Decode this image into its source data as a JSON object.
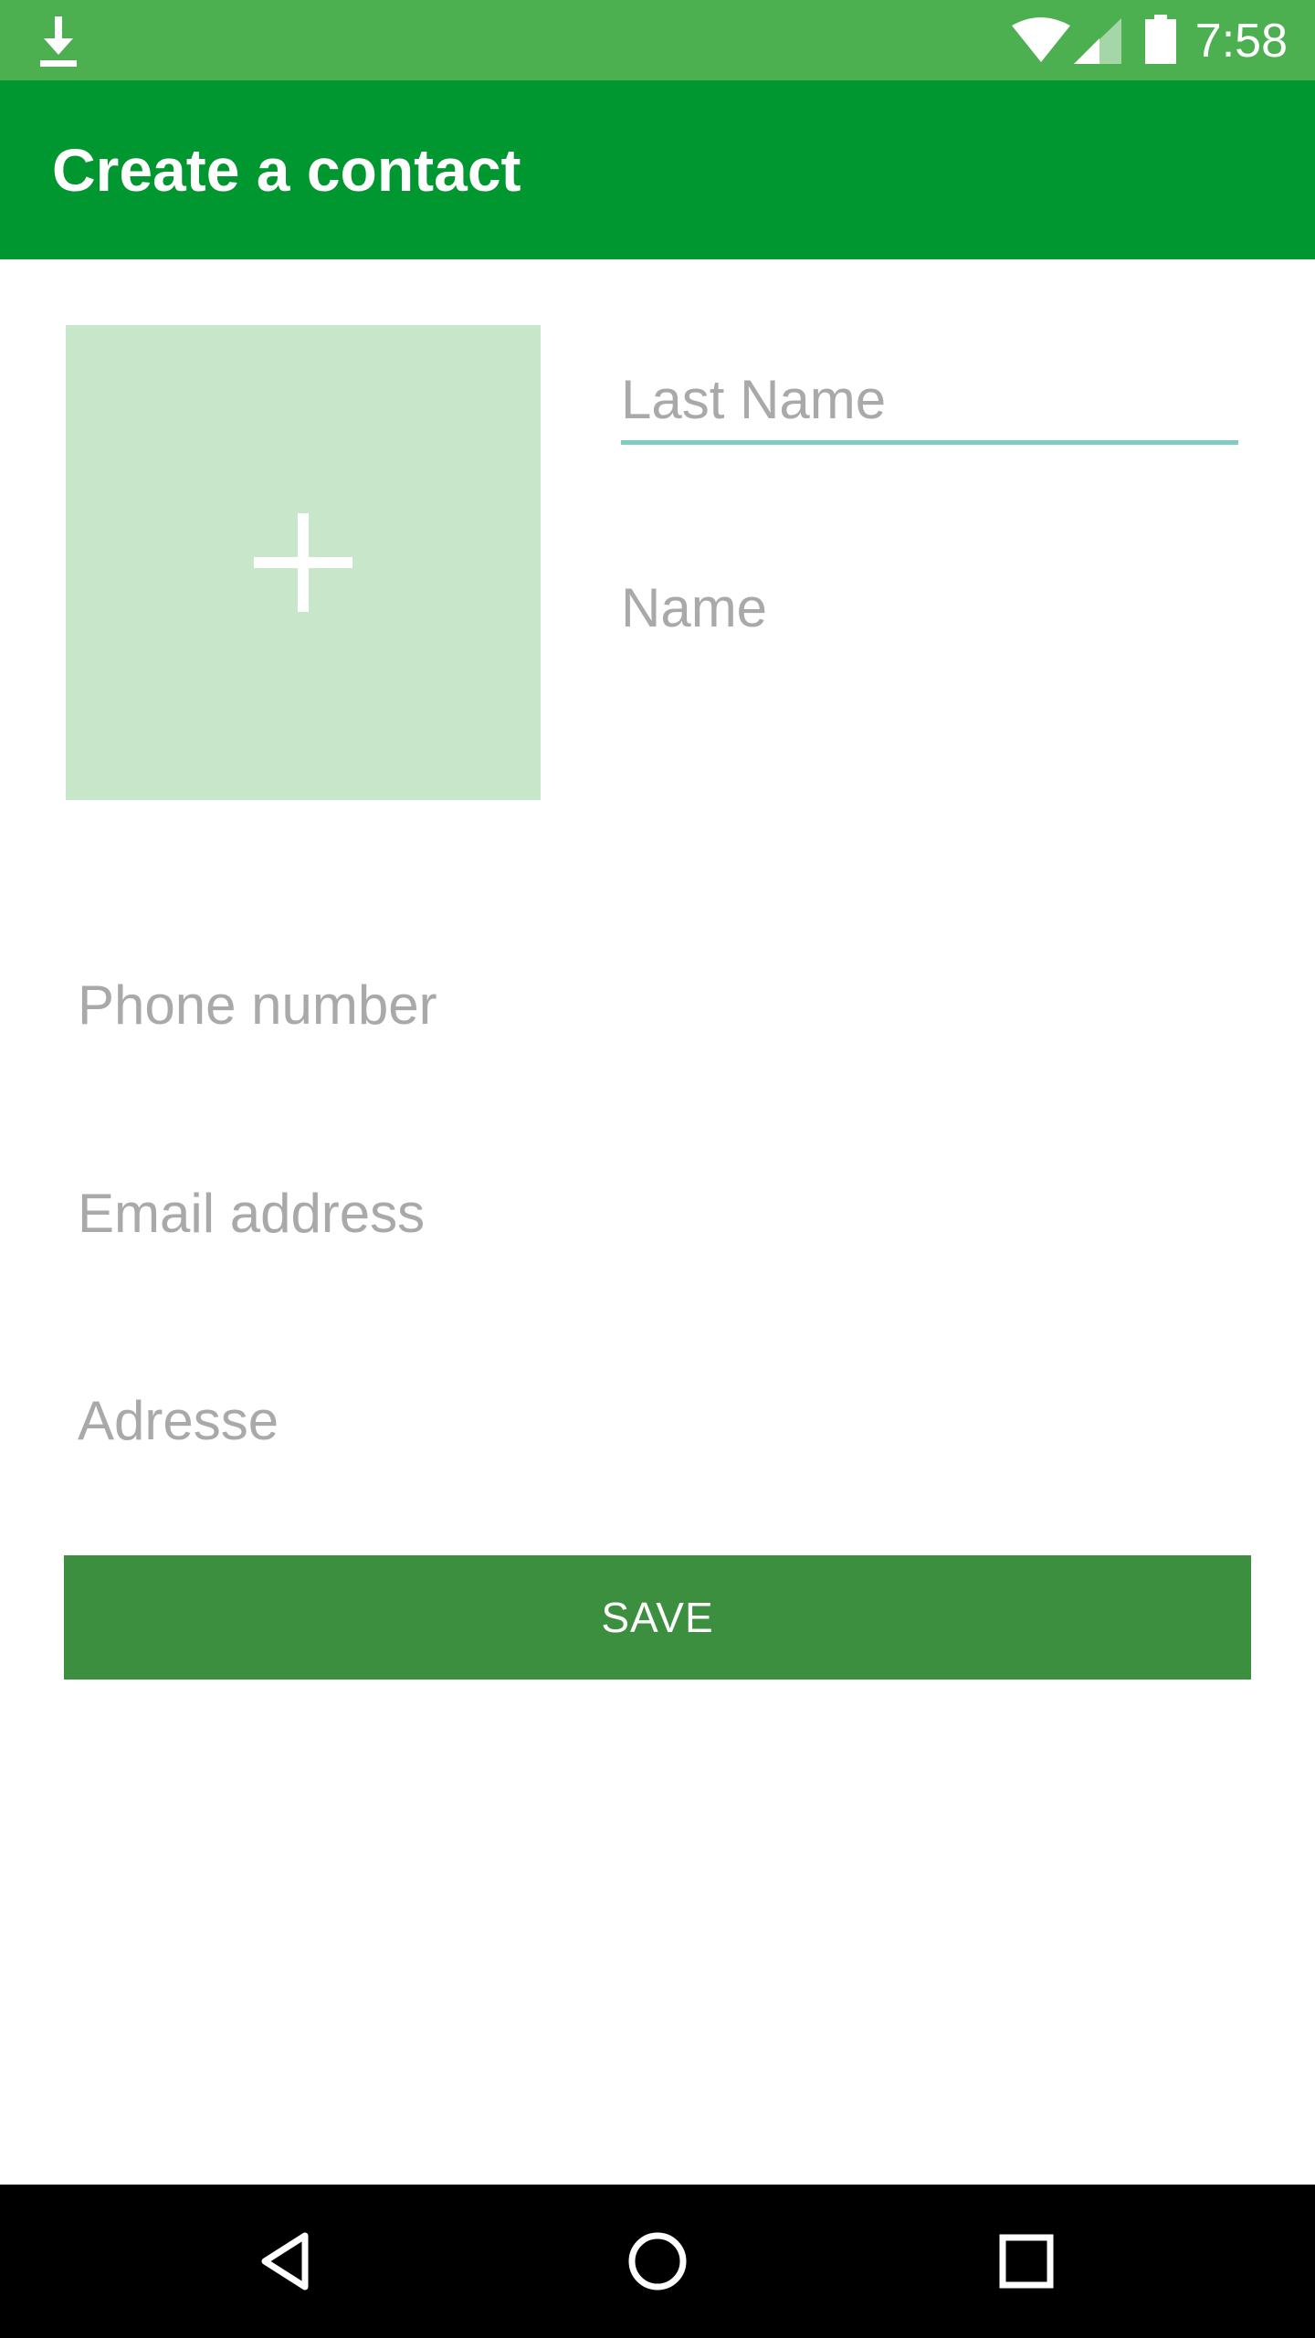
{
  "status_bar": {
    "time": "7:58",
    "color": "#4caf50",
    "icons": [
      "download-icon",
      "wifi-icon",
      "signal-icon",
      "battery-icon"
    ]
  },
  "app_bar": {
    "title": "Create a contact",
    "color": "#009630"
  },
  "photo": {
    "icon": "plus-icon",
    "color": "#c8e6c9"
  },
  "form": {
    "last_name": {
      "placeholder": "Last Name",
      "value": ""
    },
    "name": {
      "placeholder": "Name",
      "value": ""
    },
    "phone": {
      "placeholder": "Phone number",
      "value": ""
    },
    "email": {
      "placeholder": "Email address",
      "value": ""
    },
    "address": {
      "placeholder": "Adresse",
      "value": ""
    },
    "focused_field": "last_name",
    "focus_color": "#80cbc4"
  },
  "save_button": {
    "label": "SAVE",
    "color": "#3b8f3e"
  },
  "nav_bar": {
    "buttons": [
      "back-icon",
      "home-icon",
      "recents-icon"
    ]
  }
}
